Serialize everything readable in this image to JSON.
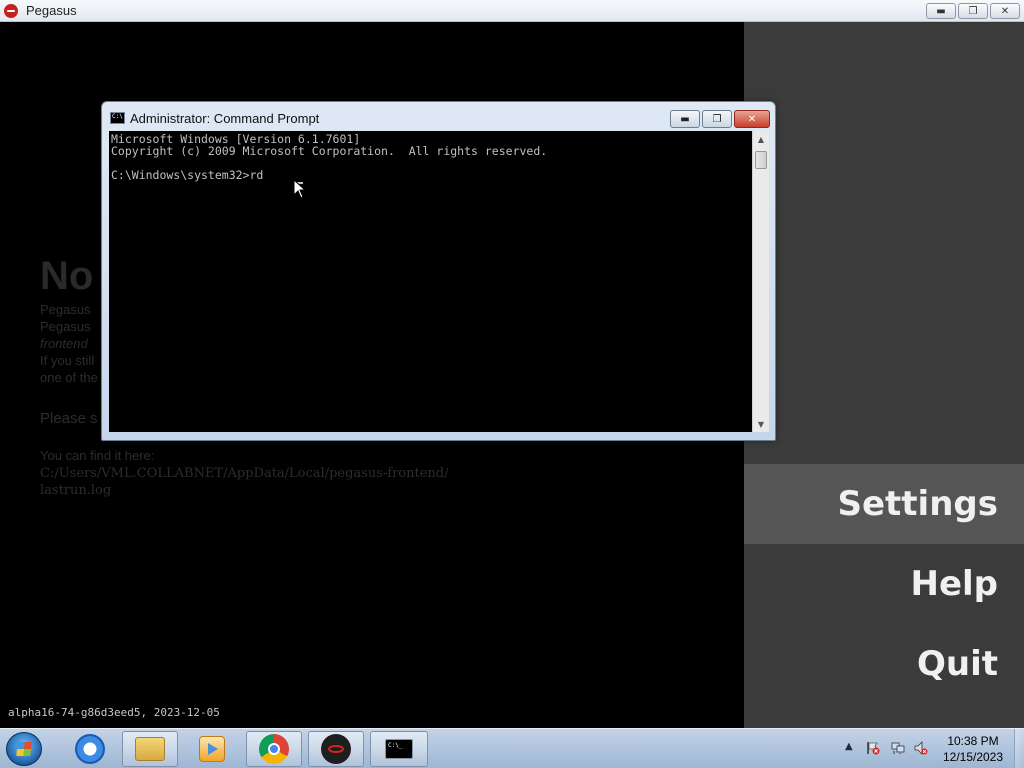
{
  "pegasus_window": {
    "title": "Pegasus",
    "minimize_glyph": "▬",
    "maximize_glyph": "❐",
    "close_glyph": "✕"
  },
  "main": {
    "error_title": "No",
    "lines": [
      "Pegasus",
      "Pegasus",
      "frontend",
      "If you still",
      "one of the"
    ],
    "please": "Please s",
    "find_here": "You can find it here:",
    "log_path_1": "C:/Users/VML.COLLABNET/AppData/Local/pegasus-frontend/",
    "log_path_2": "lastrun.log",
    "version": "alpha16-74-g86d3eed5, 2023-12-05"
  },
  "menu": {
    "items": [
      "Settings",
      "Help",
      "Quit"
    ],
    "selected": "Settings"
  },
  "cmd_window": {
    "title": "Administrator:  Command Prompt",
    "minimize_glyph": "▬",
    "maximize_glyph": "❐",
    "close_glyph": "✕",
    "console_lines": [
      "Microsoft Windows [Version 6.1.7601]",
      "Copyright (c) 2009 Microsoft Corporation.  All rights reserved.",
      "",
      "C:\\Windows\\system32>rd"
    ],
    "scroll_up": "▲",
    "scroll_down": "▼"
  },
  "taskbar": {
    "pinned": [
      "start-orb",
      "internet-explorer-icon",
      "file-explorer-icon",
      "media-player-icon",
      "chrome-icon",
      "pegasus-icon",
      "command-prompt-icon"
    ],
    "active": "command-prompt-icon",
    "tray_chevron": "▲",
    "clock_time": "10:38 PM",
    "clock_date": "12/15/2023"
  },
  "colors": {
    "menu_bg": "#3b3b3b",
    "menu_selected_bg": "#555555",
    "cmd_close_red": "#c7402a"
  }
}
